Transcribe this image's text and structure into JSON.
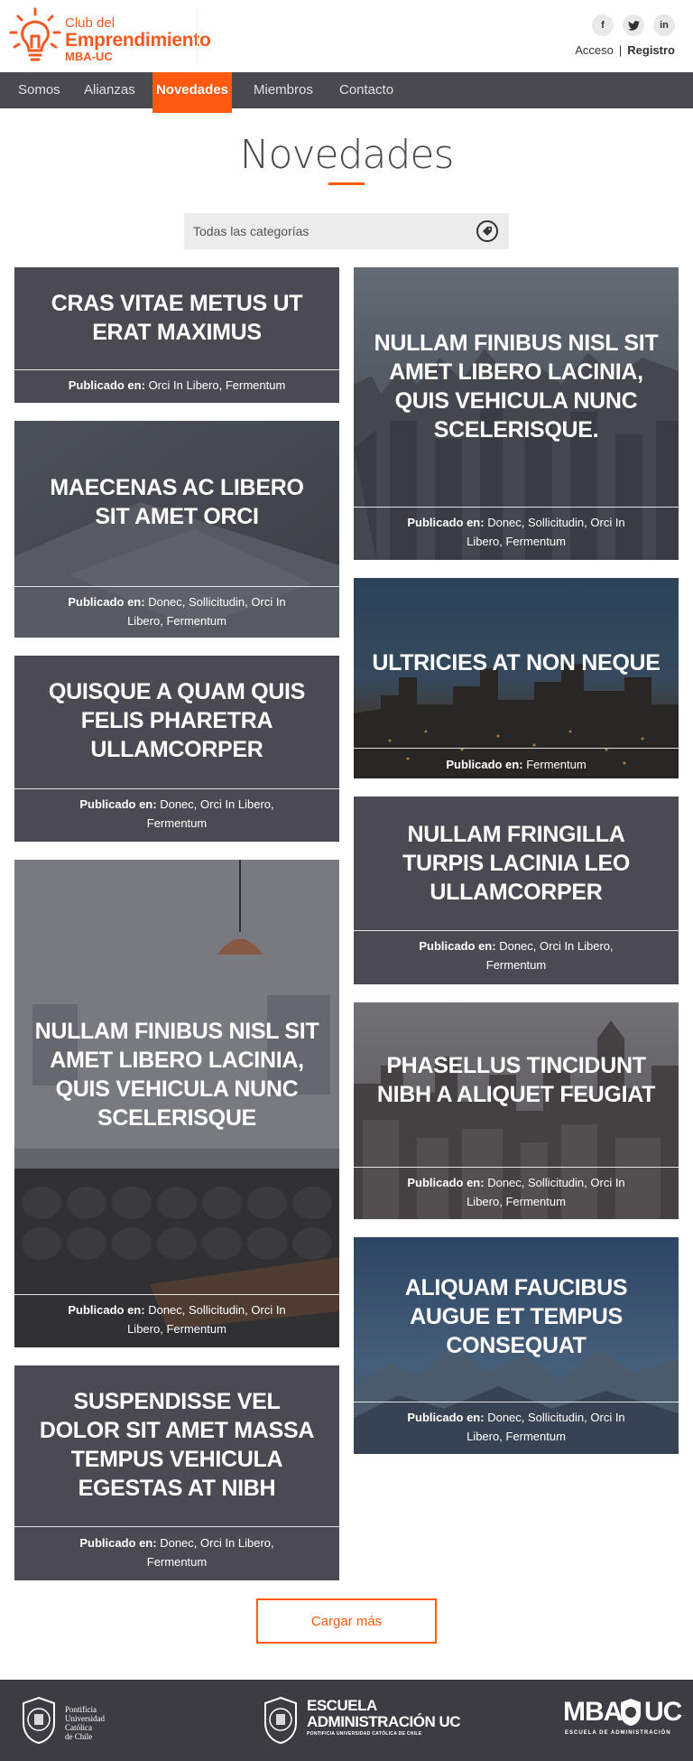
{
  "header": {
    "logo": {
      "line1": "Club del",
      "line2": "Emprendimiento",
      "line3": "MBA-UC"
    },
    "social": [
      {
        "icon": "facebook-icon",
        "glyph": "f"
      },
      {
        "icon": "twitter-icon",
        "glyph": "t"
      },
      {
        "icon": "linkedin-icon",
        "glyph": "in"
      }
    ],
    "login": "Acceso",
    "separator": "|",
    "register": "Registro"
  },
  "nav": {
    "items": [
      "Somos",
      "Alianzas",
      "Novedades",
      "Miembros",
      "Contacto"
    ],
    "active": "Novedades"
  },
  "page": {
    "title": "Novedades",
    "filter_placeholder": "Todas las categorías"
  },
  "meta_label": "Publicado en:",
  "cards": [
    {
      "title": "CRAS VITAE METUS UT ERAT MAXIMUS",
      "categories": "Orci In Libero, Fermentum"
    },
    {
      "title": "NULLAM FINIBUS NISL SIT AMET LIBERO LACINIA, QUIS VEHICULA NUNC SCELERISQUE.",
      "categories": "Donec, Sollicitudin, Orci In Libero, Fermentum"
    },
    {
      "title": "MAECENAS AC LIBERO SIT AMET ORCI",
      "categories": "Donec, Sollicitudin, Orci In Libero, Fermentum"
    },
    {
      "title": "ULTRICIES AT NON NEQUE",
      "categories": "Fermentum"
    },
    {
      "title": "QUISQUE A QUAM QUIS FELIS PHARETRA ULLAMCORPER",
      "categories": "Donec, Orci In Libero, Fermentum"
    },
    {
      "title": "NULLAM FRINGILLA TURPIS LACINIA LEO ULLAMCORPER",
      "categories": "Donec, Orci In Libero, Fermentum"
    },
    {
      "title": "NULLAM FINIBUS NISL SIT AMET LIBERO LACINIA, QUIS VEHICULA NUNC SCELERISQUE",
      "categories": "Donec, Sollicitudin, Orci In Libero, Fermentum"
    },
    {
      "title": "PHASELLUS TINCIDUNT NIBH A ALIQUET FEUGIAT",
      "categories": "Donec, Sollicitudin, Orci In Libero, Fermentum"
    },
    {
      "title": "ALIQUAM FAUCIBUS AUGUE ET TEMPUS CONSEQUAT",
      "categories": "Donec, Sollicitudin, Orci In Libero, Fermentum"
    },
    {
      "title": "SUSPENDISSE VEL DOLOR SIT AMET MASSA TEMPUS VEHICULA EGESTAS AT NIBH",
      "categories": "Donec, Orci In Libero, Fermentum"
    }
  ],
  "load_more": "Cargar más",
  "footer": {
    "puc": [
      "Pontificia",
      "Universidad",
      "Católica",
      "de Chile"
    ],
    "escuela_l1": "ESCUELA",
    "escuela_l2": "ADMINISTRACIÓN UC",
    "escuela_l3": "PONTIFICIA UNIVERSIDAD CATÓLICA DE CHILE",
    "mba_l1": "MBA",
    "mba_l2": "UC",
    "mba_l3": "ESCUELA DE ADMINISTRACIÓN"
  },
  "colors": {
    "accent": "#ff5a10",
    "nav": "#4a4950",
    "card": "#4b4a52",
    "footer": "#3d3c43"
  }
}
